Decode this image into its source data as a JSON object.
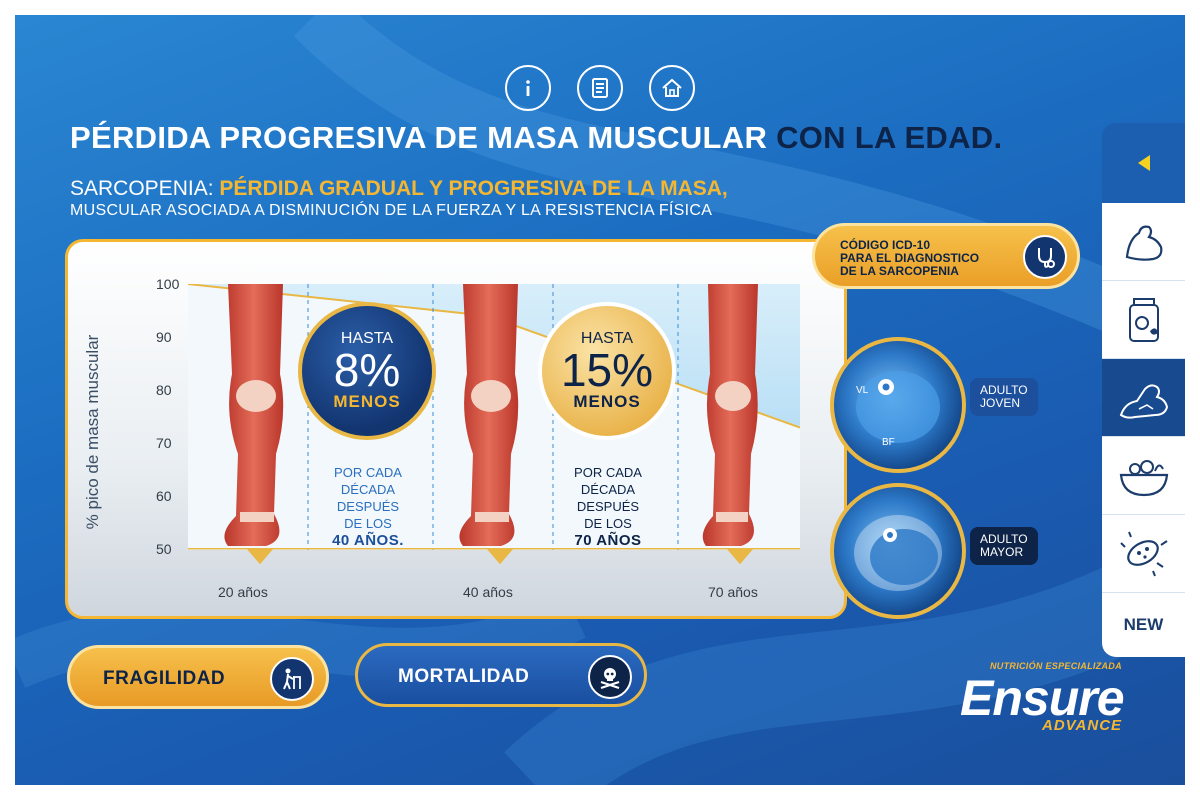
{
  "top_icons": [
    "info-icon",
    "book-icon",
    "home-icon"
  ],
  "title": {
    "white_part": "PÉRDIDA PROGRESIVA DE MASA MUSCULAR",
    "dark_part": "CON LA EDAD."
  },
  "subtitle": {
    "prefix": "SARCOPENIA:",
    "highlight": "PÉRDIDA GRADUAL Y PROGRESIVA DE LA MASA,",
    "line2": "MUSCULAR ASOCIADA A DISMINUCIÓN DE LA FUERZA Y LA RESISTENCIA FÍSICA"
  },
  "chart": {
    "y_axis_label": "% pico de masa muscular",
    "y_ticks": [
      "100",
      "90",
      "80",
      "70",
      "60",
      "50"
    ],
    "x_ticks": [
      "20 años",
      "40 años",
      "70 años"
    ],
    "badge_1": {
      "top": "HASTA",
      "value": "8%",
      "bottom": "MENOS"
    },
    "badge_2": {
      "top": "HASTA",
      "value": "15%",
      "bottom": "MENOS"
    },
    "note_1": {
      "line1": "POR CADA",
      "line2": "DÉCADA",
      "line3": "DESPUÉS",
      "line4": "DE LOS",
      "line5": "40 AÑOS."
    },
    "note_2": {
      "line1": "POR CADA",
      "line2": "DÉCADA",
      "line3": "DESPUÉS",
      "line4": "DE LOS",
      "line5": "70 AÑOS"
    }
  },
  "chart_data": {
    "type": "area",
    "x": [
      "20 años",
      "40 años",
      "70 años"
    ],
    "ylabel": "% pico de masa muscular",
    "ylim": [
      50,
      100
    ],
    "series": [
      {
        "values": [
          100,
          94,
          73
        ]
      }
    ]
  },
  "icd_button": {
    "line1": "CÓDIGO ICD-10",
    "line2": "PARA EL DIAGNOSTICO",
    "line3": "DE LA SARCOPENIA"
  },
  "scans": {
    "young": {
      "label1": "ADULTO",
      "label2": "JOVEN",
      "tag_vl": "VL",
      "tag_bf": "BF"
    },
    "old": {
      "label1": "ADULTO",
      "label2": "MAYOR"
    }
  },
  "buttons": {
    "fragility": "FRAGILIDAD",
    "mortality": "MORTALIDAD"
  },
  "brand": {
    "tagline": "NUTRICIÓN ESPECIALIZADA",
    "name": "Ensure",
    "sub": "ADVANCE"
  },
  "sidebar": {
    "items": [
      "muscle-arm-icon",
      "supplement-jar-icon",
      "arm-strength-icon",
      "food-bowl-icon",
      "bacteria-icon"
    ],
    "active_index": 2,
    "new_label": "NEW"
  },
  "colors": {
    "accent": "#f5b731",
    "navy": "#0d2347",
    "background_blue": "#1b6cc0"
  }
}
